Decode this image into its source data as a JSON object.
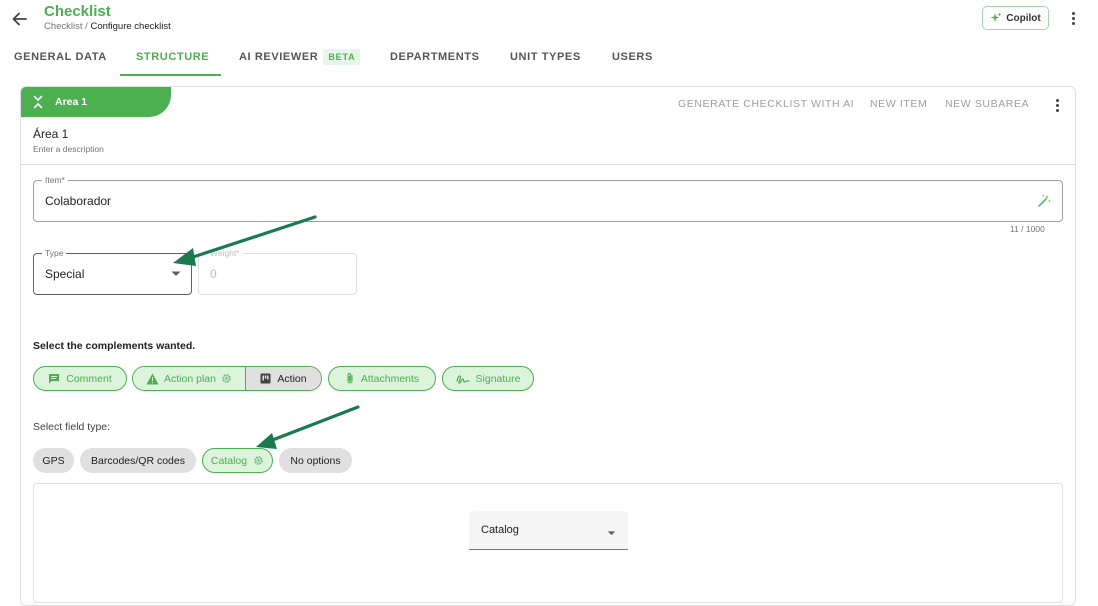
{
  "header": {
    "title": "Checklist",
    "breadcrumb_parent": "Checklist",
    "breadcrumb_separator": " / ",
    "breadcrumb_current": "Configure checklist",
    "copilot_label": "Copilot"
  },
  "tabs": [
    {
      "label": "GENERAL DATA"
    },
    {
      "label": "STRUCTURE",
      "active": true
    },
    {
      "label": "AI REVIEWER",
      "badge": "BETA"
    },
    {
      "label": "DEPARTMENTS"
    },
    {
      "label": "UNIT TYPES"
    },
    {
      "label": "USERS"
    }
  ],
  "area": {
    "tab_label": "Area 1",
    "name": "Área 1",
    "description_placeholder": "Enter a description",
    "actions": {
      "generate": "GENERATE CHECKLIST WITH AI",
      "new_item": "NEW ITEM",
      "new_subarea": "NEW SUBAREA"
    }
  },
  "item": {
    "label": "Item*",
    "value": "Colaborador",
    "counter": "11 / 1000"
  },
  "type_field": {
    "label": "Type",
    "value": "Special"
  },
  "weight_field": {
    "label": "Weight*",
    "value": "0"
  },
  "complements": {
    "label": "Select the complements wanted.",
    "comment": "Comment",
    "action_plan": "Action plan",
    "action": "Action",
    "attachments": "Attachments",
    "signature": "Signature"
  },
  "field_type": {
    "label": "Select field type:",
    "gps": "GPS",
    "barcodes": "Barcodes/QR codes",
    "catalog": "Catalog",
    "no_options": "No options"
  },
  "catalog_select": {
    "value": "Catalog"
  },
  "colors": {
    "primary": "#4caf50",
    "chip_bg": "#dcf3dc",
    "arrow": "#1b7a4e"
  },
  "icons": [
    "arrow-back-icon",
    "sparkle-icon",
    "more-vert-icon",
    "chevron-collapse-icon",
    "magic-wand-icon",
    "dropdown-arrow-icon",
    "comment-icon",
    "warning-icon",
    "gear-icon",
    "action-icon",
    "paperclip-icon",
    "signature-icon"
  ]
}
